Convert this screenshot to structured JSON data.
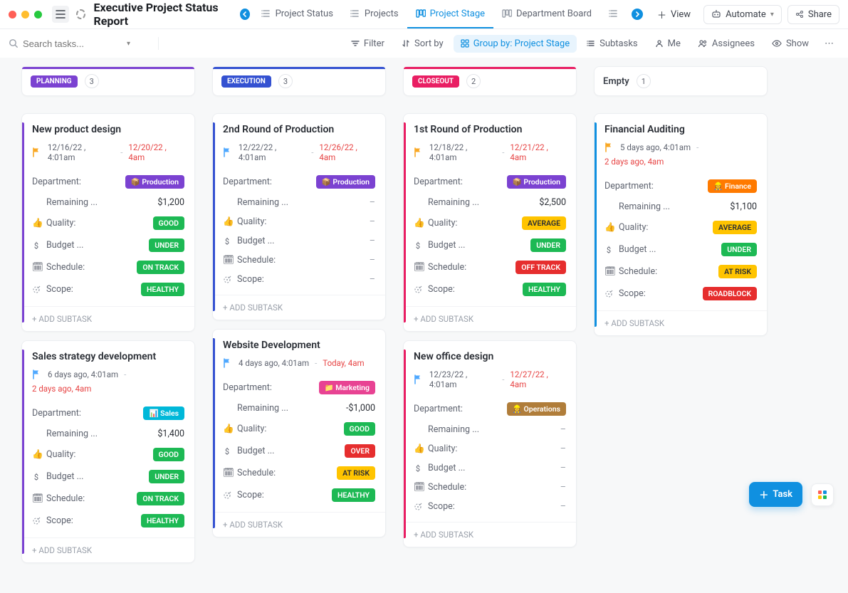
{
  "header": {
    "title": "Executive Project Status Report",
    "tabs": [
      {
        "label": "Project Status",
        "active": false
      },
      {
        "label": "Projects",
        "active": false
      },
      {
        "label": "Project Stage",
        "active": true
      },
      {
        "label": "Department Board",
        "active": false
      }
    ],
    "view_label": "View",
    "automate_label": "Automate",
    "share_label": "Share"
  },
  "toolbar": {
    "search_placeholder": "Search tasks...",
    "filter": "Filter",
    "sort": "Sort by",
    "group": "Group by: Project Stage",
    "subtasks": "Subtasks",
    "me": "Me",
    "assignees": "Assignees",
    "show": "Show"
  },
  "columns": [
    {
      "id": "planning",
      "label": "PLANNING",
      "count": "3",
      "stripe": "#7b42d1"
    },
    {
      "id": "execution",
      "label": "EXECUTION",
      "count": "3",
      "stripe": "#3451d1"
    },
    {
      "id": "closeout",
      "label": "CLOSEOUT",
      "count": "2",
      "stripe": "#e91e63"
    },
    {
      "id": "empty",
      "label": "Empty",
      "count": "1",
      "stripe": null
    }
  ],
  "labels": {
    "department": "Department:",
    "remaining": "Remaining ...",
    "quality": "Quality:",
    "budget": "Budget ...",
    "schedule": "Schedule:",
    "scope": "Scope:",
    "add_subtask": "+ ADD SUBTASK"
  },
  "cards": {
    "planning": [
      {
        "title": "New product design",
        "flag": "#f9a825",
        "date1": "12/16/22 , 4:01am",
        "date2": "12/20/22 , 4am",
        "date2_wrap": false,
        "department": {
          "label": "Production",
          "emoji": "📦",
          "class": "dep-production"
        },
        "remaining": "$1,200",
        "quality": {
          "label": "GOOD",
          "class": "good"
        },
        "budget": {
          "label": "UNDER",
          "class": "under"
        },
        "schedule": {
          "label": "ON TRACK",
          "class": "ontrack"
        },
        "scope": {
          "label": "HEALTHY",
          "class": "healthy"
        }
      },
      {
        "title": "Sales strategy development",
        "flag": "#4fa8ff",
        "date1": "6 days ago, 4:01am",
        "date2": "2 days ago, 4am",
        "date2_wrap": true,
        "department": {
          "label": "Sales",
          "emoji": "📊",
          "class": "dep-sales"
        },
        "remaining": "$1,400",
        "quality": {
          "label": "GOOD",
          "class": "good"
        },
        "budget": {
          "label": "UNDER",
          "class": "under"
        },
        "schedule": {
          "label": "ON TRACK",
          "class": "ontrack"
        },
        "scope": {
          "label": "HEALTHY",
          "class": "healthy"
        }
      }
    ],
    "execution": [
      {
        "title": "2nd Round of Production",
        "flag": "#4fa8ff",
        "date1": "12/22/22 , 4:01am",
        "date2": "12/26/22 , 4am",
        "date2_wrap": false,
        "department": {
          "label": "Production",
          "emoji": "📦",
          "class": "dep-production"
        },
        "remaining": null,
        "quality": null,
        "budget": null,
        "schedule": null,
        "scope": null
      },
      {
        "title": "Website Development",
        "flag": "#4fa8ff",
        "date1": "4 days ago, 4:01am",
        "date2": "Today, 4am",
        "date2_wrap": false,
        "department": {
          "label": "Marketing",
          "emoji": "📁",
          "class": "dep-marketing"
        },
        "remaining": "-$1,000",
        "quality": {
          "label": "GOOD",
          "class": "good"
        },
        "budget": {
          "label": "OVER",
          "class": "over"
        },
        "schedule": {
          "label": "AT RISK",
          "class": "atrisk"
        },
        "scope": {
          "label": "HEALTHY",
          "class": "healthy"
        }
      }
    ],
    "closeout": [
      {
        "title": "1st Round of Production",
        "flag": "#f9a825",
        "date1": "12/18/22 , 4:01am",
        "date2": "12/21/22 , 4am",
        "date2_wrap": false,
        "department": {
          "label": "Production",
          "emoji": "📦",
          "class": "dep-production"
        },
        "remaining": "$2,500",
        "quality": {
          "label": "AVERAGE",
          "class": "average"
        },
        "budget": {
          "label": "UNDER",
          "class": "under"
        },
        "schedule": {
          "label": "OFF TRACK",
          "class": "offtrack"
        },
        "scope": {
          "label": "HEALTHY",
          "class": "healthy"
        }
      },
      {
        "title": "New office design",
        "flag": "#4fa8ff",
        "date1": "12/23/22 , 4:01am",
        "date2": "12/27/22 , 4am",
        "date2_wrap": false,
        "department": {
          "label": "Operations",
          "emoji": "👷",
          "class": "dep-operations"
        },
        "remaining": null,
        "quality": null,
        "budget": null,
        "schedule": null,
        "scope": null
      }
    ],
    "empty": [
      {
        "title": "Financial Auditing",
        "flag": "#f9a825",
        "date1": "5 days ago, 4:01am",
        "date2": "2 days ago, 4am",
        "date2_wrap": true,
        "department": {
          "label": "Finance",
          "emoji": "👷",
          "class": "dep-finance"
        },
        "remaining": "$1,100",
        "quality": {
          "label": "AVERAGE",
          "class": "average"
        },
        "budget": {
          "label": "UNDER",
          "class": "under"
        },
        "schedule": {
          "label": "AT RISK",
          "class": "atrisk"
        },
        "scope": {
          "label": "ROADBLOCK",
          "class": "roadblock"
        }
      }
    ]
  },
  "float": {
    "task_label": "Task"
  }
}
